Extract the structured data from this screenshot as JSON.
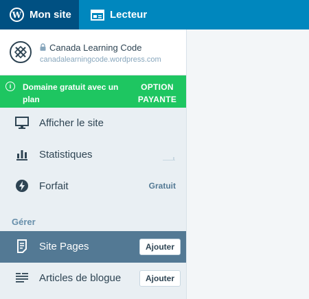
{
  "masterbar": {
    "my_site_label": "Mon site",
    "reader_label": "Lecteur"
  },
  "site": {
    "title": "Canada Learning Code",
    "url": "canadalearningcode.wordpress.com"
  },
  "upsell": {
    "message": "Domaine gratuit avec un plan",
    "cta": "OPTION PAYANTE",
    "color": "#1ec661"
  },
  "menu": {
    "view_site": "Afficher le site",
    "stats": "Statistiques",
    "plan": "Forfait",
    "plan_badge": "Gratuit",
    "manage_heading": "Gérer",
    "site_pages": "Site Pages",
    "site_pages_add": "Ajouter",
    "blog_posts": "Articles de blogue",
    "blog_posts_add": "Ajouter"
  },
  "colors": {
    "masterbar": "#0087be",
    "masterbar_active": "#005082",
    "active_item": "#537994"
  }
}
